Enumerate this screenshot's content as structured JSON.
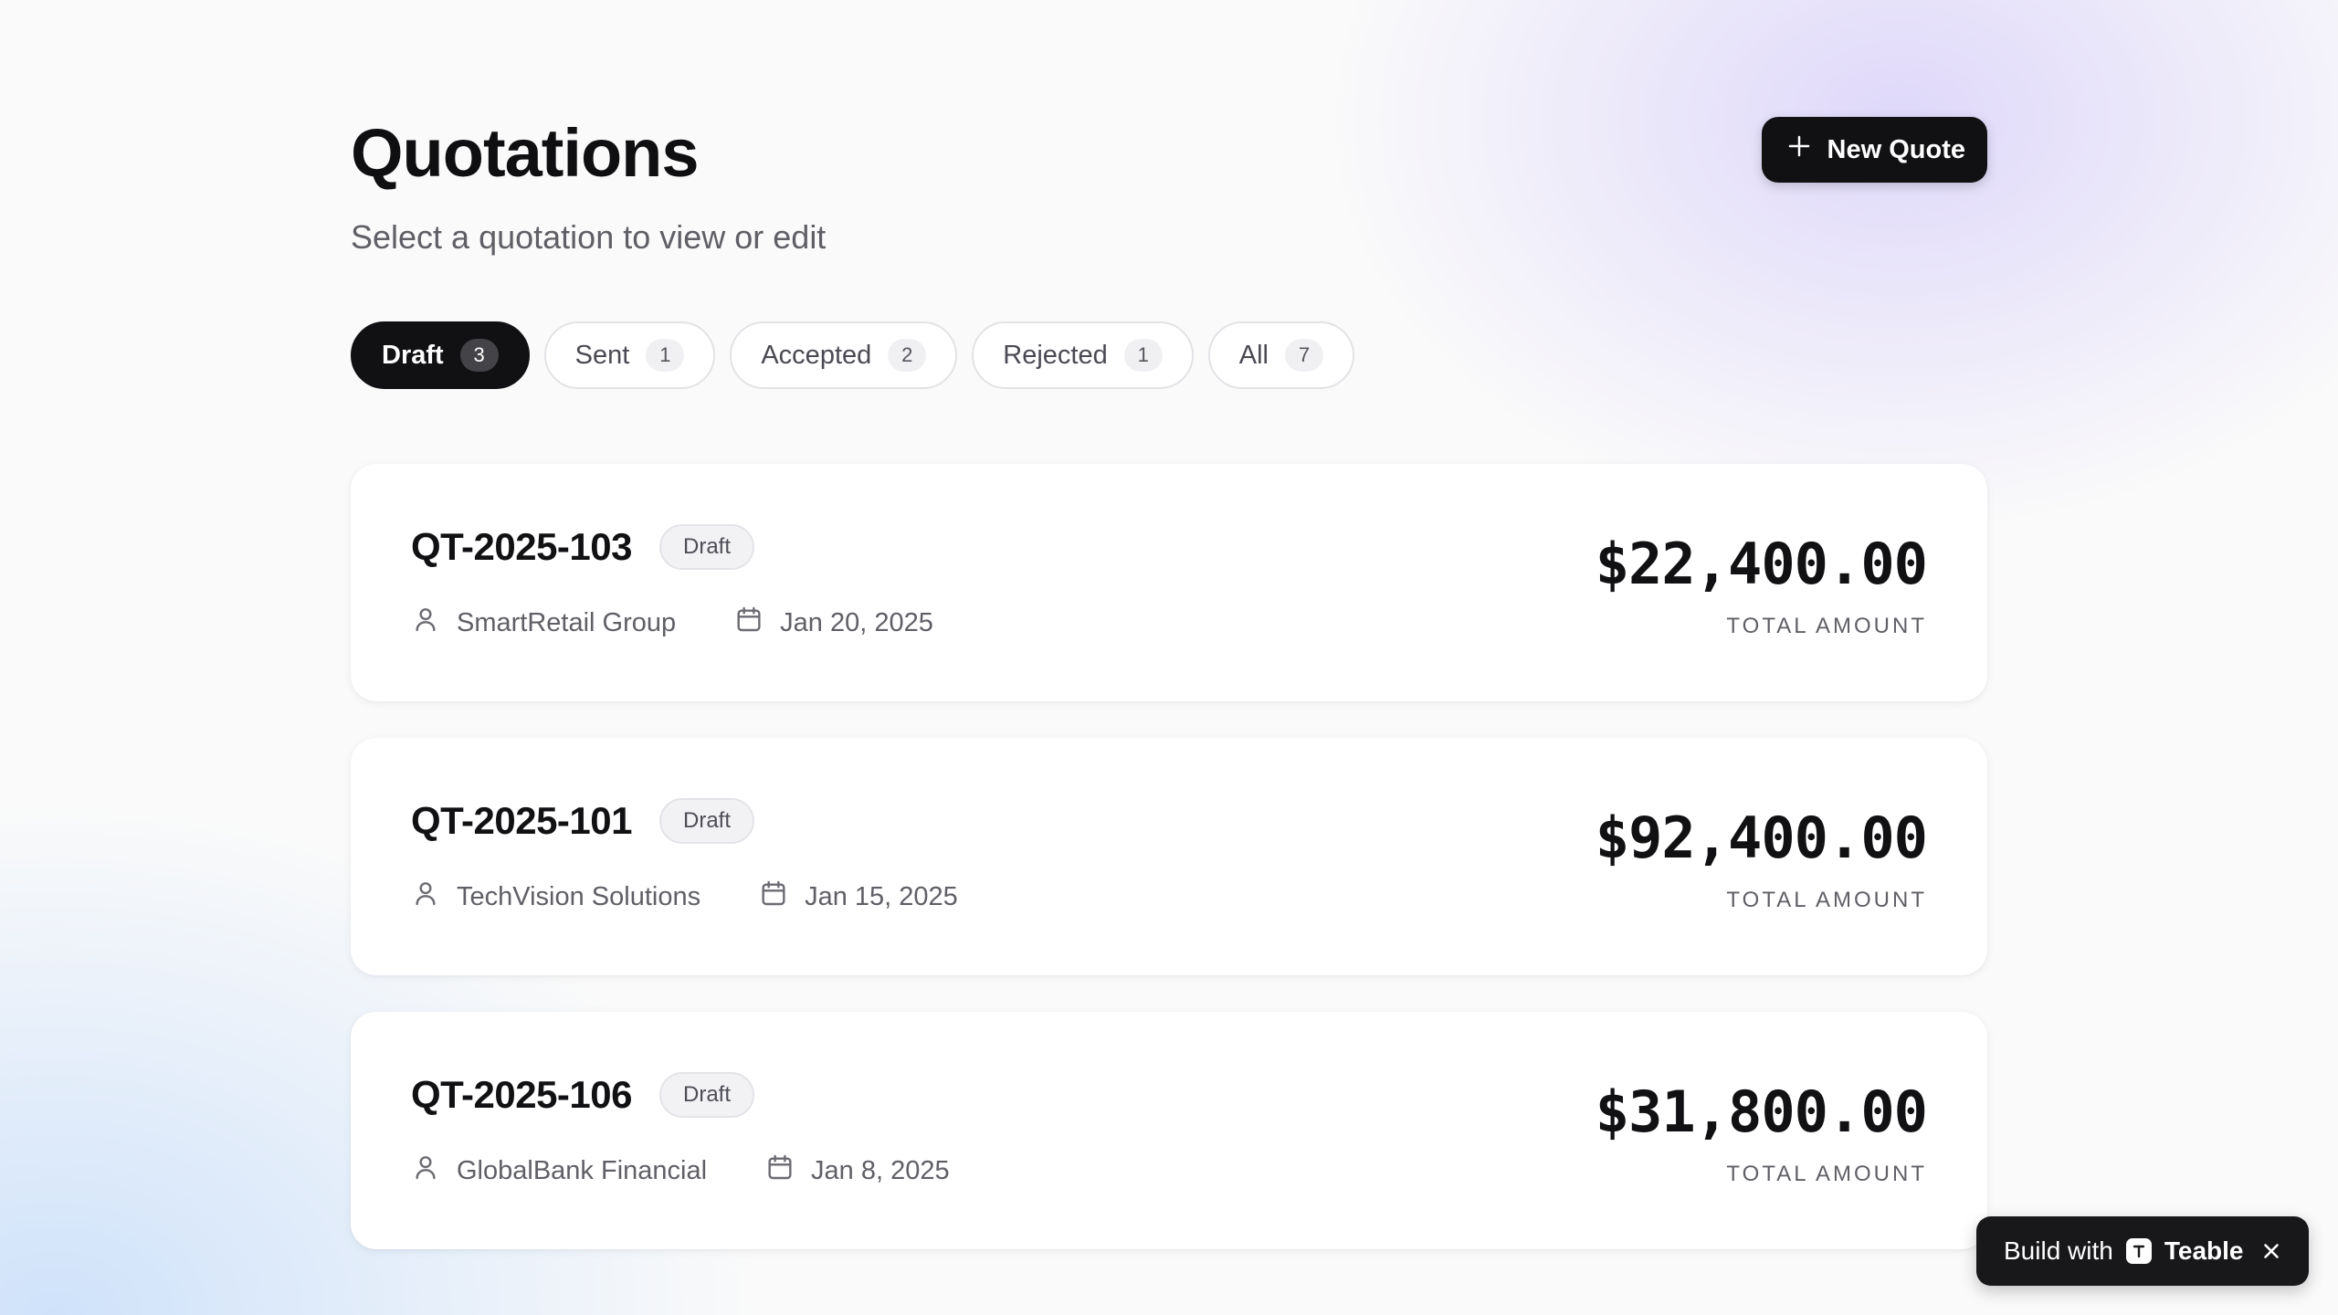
{
  "header": {
    "title": "Quotations",
    "subtitle": "Select a quotation to view or edit",
    "new_button_label": "New Quote"
  },
  "tabs": [
    {
      "label": "Draft",
      "count": "3",
      "active": true
    },
    {
      "label": "Sent",
      "count": "1",
      "active": false
    },
    {
      "label": "Accepted",
      "count": "2",
      "active": false
    },
    {
      "label": "Rejected",
      "count": "1",
      "active": false
    },
    {
      "label": "All",
      "count": "7",
      "active": false
    }
  ],
  "quotes": [
    {
      "id": "QT-2025-103",
      "status": "Draft",
      "customer": "SmartRetail Group",
      "date": "Jan 20, 2025",
      "amount": "$22,400.00",
      "amount_label": "TOTAL AMOUNT"
    },
    {
      "id": "QT-2025-101",
      "status": "Draft",
      "customer": "TechVision Solutions",
      "date": "Jan 15, 2025",
      "amount": "$92,400.00",
      "amount_label": "TOTAL AMOUNT"
    },
    {
      "id": "QT-2025-106",
      "status": "Draft",
      "customer": "GlobalBank Financial",
      "date": "Jan 8, 2025",
      "amount": "$31,800.00",
      "amount_label": "TOTAL AMOUNT"
    }
  ],
  "badge": {
    "prefix": "Build with",
    "brand": "Teable"
  },
  "icons": {
    "new_button": "plus-icon",
    "customer": "user-icon",
    "date": "calendar-icon",
    "badge_logo": "teable-logo-icon",
    "badge_close": "close-icon"
  },
  "colors": {
    "primary": "#111114",
    "muted_text": "#5f5f66",
    "card_background": "#ffffff",
    "badge_background": "#f2f2f5"
  }
}
